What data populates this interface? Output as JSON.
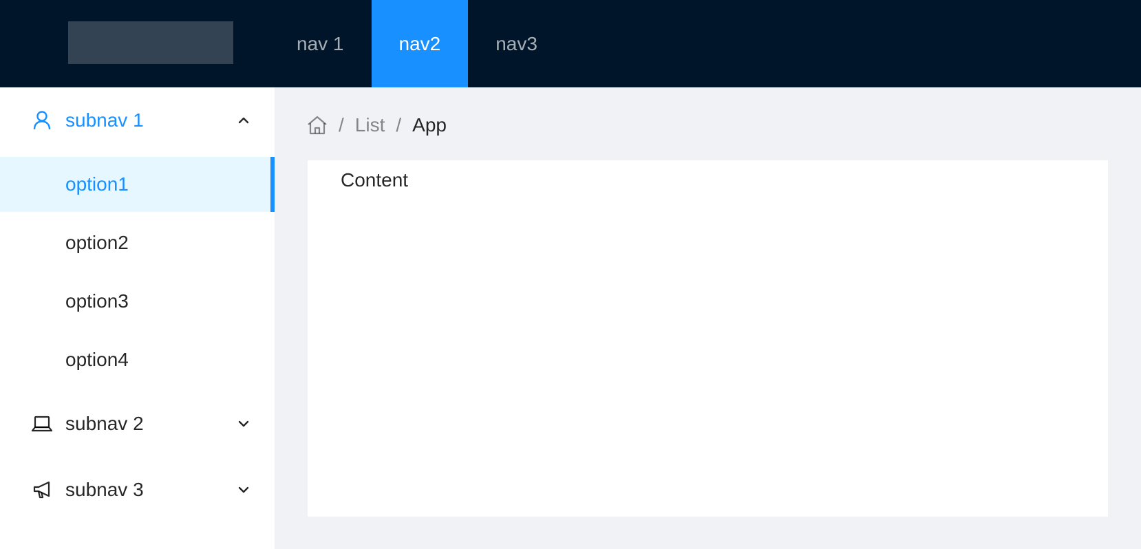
{
  "header": {
    "nav": [
      {
        "label": "nav 1"
      },
      {
        "label": "nav2",
        "active": true
      },
      {
        "label": "nav3"
      }
    ]
  },
  "sidebar": {
    "submenus": [
      {
        "label": "subnav 1",
        "icon": "user-icon",
        "open": true,
        "options": [
          {
            "label": "option1",
            "selected": true
          },
          {
            "label": "option2"
          },
          {
            "label": "option3"
          },
          {
            "label": "option4"
          }
        ]
      },
      {
        "label": "subnav 2",
        "icon": "laptop-icon",
        "open": false
      },
      {
        "label": "subnav 3",
        "icon": "notification-icon",
        "open": false
      }
    ]
  },
  "breadcrumb": {
    "items": [
      {
        "icon": "home-icon"
      },
      {
        "label": "List"
      },
      {
        "label": "App"
      }
    ]
  },
  "main": {
    "content_text": "Content"
  },
  "colors": {
    "header_bg": "#001529",
    "accent": "#1890ff",
    "selected_bg": "#e6f7ff",
    "page_bg": "#f0f2f5"
  }
}
